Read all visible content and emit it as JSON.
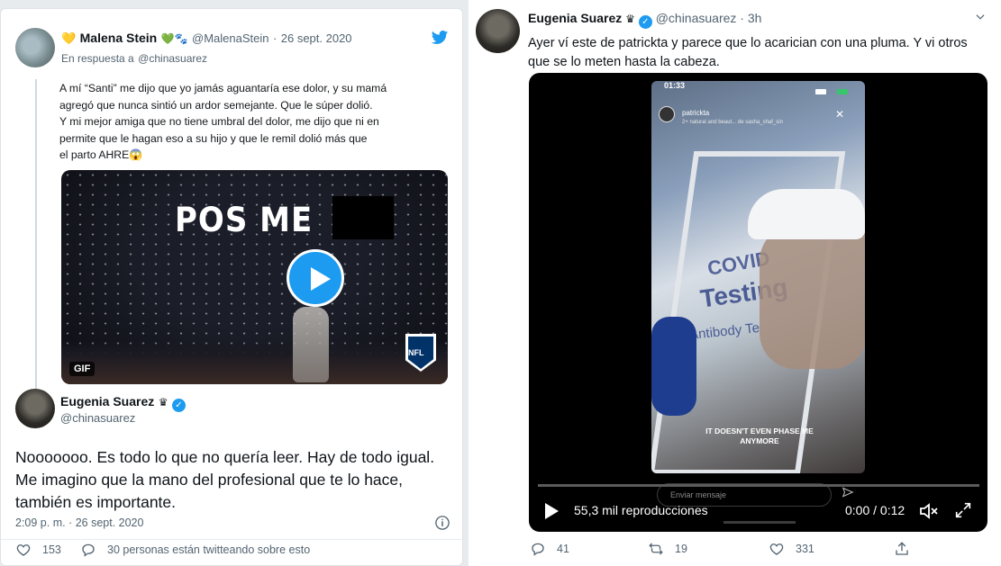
{
  "left": {
    "parent": {
      "name": "Malena Stein",
      "name_emoji_1": "💛",
      "name_emoji_2": "💚🐾",
      "handle": "@MalenaStein",
      "separator": "·",
      "date": "26 sept. 2020",
      "reply_label": "En respuesta a",
      "reply_handle": "@chinasuarez",
      "text": "A mí “Santi” me dijo que yo jamás aguantaría ese dolor, y su mamá\nagregó que nunca sintió un ardor semejante. Que le súper dolió.\nY mi mejor amiga que no tiene umbral del dolor, me dijo que ni en\npermite que le hagan eso a su hijo y que le remil dolió más que\nel parto AHRE😱",
      "gif_title": "POS ME",
      "gif_badge": "GIF",
      "gif_logo": "NFL"
    },
    "main": {
      "name": "Eugenia Suarez",
      "name_icon": "♛",
      "handle": "@chinasuarez",
      "text": "Nooooooo. Es todo lo que no quería leer. Hay de todo igual. Me imagino que la mano del profesional que te lo hace, también es importante.",
      "timestamp": "2:09 p. m. · 26 sept. 2020",
      "likes": "153",
      "talking": "30 personas están twitteando sobre esto"
    }
  },
  "right": {
    "name": "Eugenia Suarez",
    "name_icon": "♛",
    "handle": "@chinasuarez",
    "separator": "·",
    "time_ago": "3h",
    "text": "Ayer ví este de patrickta y parece que lo acarician con una pluma. Y vi otros que se lo meten hasta la cabeza.",
    "video": {
      "phone_time": "01:33",
      "ig_user": "patrickta",
      "ig_sub": "2+ natural and beaut... de sasha_shaf_sin",
      "caption": "IT DOESN'T EVEN PHASE ME ANYMORE",
      "sign_covid": "COVID",
      "sign_testing": "Testing",
      "sign_antibody": "Antibody Te",
      "send_placeholder": "Enviar mensaje",
      "views": "55,3 mil reproducciones",
      "time": "0:00 / 0:12"
    },
    "replies": "41",
    "retweets": "19",
    "likes": "331"
  },
  "colors": {
    "accent": "#1d9bf0",
    "text": "#0f1419",
    "secondary": "#536471"
  }
}
